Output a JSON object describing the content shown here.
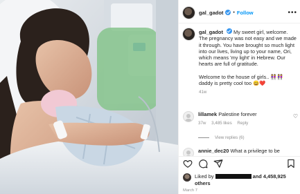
{
  "post": {
    "username": "gal_gadot",
    "follow_label": "Follow",
    "caption_p1": "My sweet girl, welcome. The pregnancy was not easy and we made it through. You have brought so much light into our lives, living up to your name, Ori, which means 'my light' in Hebrew. Our hearts are full of gratitude.",
    "caption_p2": "Welcome to the house of girls.. 👭👭 daddy is pretty cool too 😄❤️",
    "time_ago": "41w"
  },
  "comments": [
    {
      "username": "lillamek",
      "text": "Palestine forever",
      "time": "37w",
      "likes": "3,485 likes",
      "reply": "Reply"
    },
    {
      "username": "annie_dec20",
      "text": "What a privilege to be"
    }
  ],
  "view_replies": "View replies (6)",
  "likes": {
    "prefix": "Liked by",
    "suffix": "and 4,458,925 others"
  },
  "date": "March 7",
  "colors": {
    "accent": "#0095f6",
    "verified": "#3897f0",
    "muted": "#8e8e8e"
  },
  "icons": [
    "verified-badge-icon",
    "more-options-icon",
    "heart-icon",
    "comment-icon",
    "share-icon",
    "bookmark-icon"
  ]
}
